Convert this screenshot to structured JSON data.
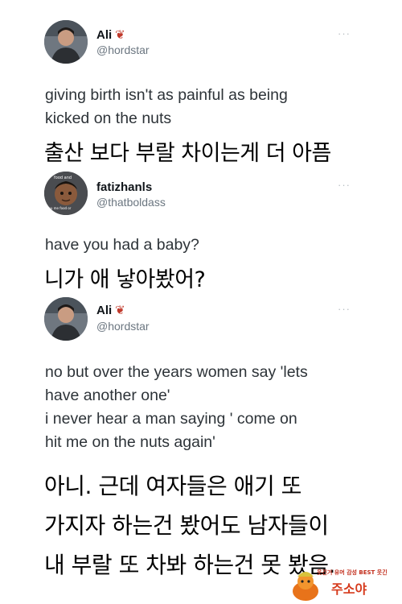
{
  "tweets": [
    {
      "name": "Ali",
      "handle": "@hordstar",
      "more": "···",
      "lines": [
        "giving birth isn't as painful as being",
        "kicked on the nuts"
      ],
      "translation": [
        "출산 보다 부랄 차이는게 더 아픔"
      ]
    },
    {
      "name": "fatizhanls",
      "handle": "@thatboldass",
      "more": "···",
      "avatar_text": "food and / you me food or ...",
      "lines": [
        "have you had a baby?"
      ],
      "translation": [
        "니가 애 낳아봤어?"
      ]
    },
    {
      "name": "Ali",
      "handle": "@hordstar",
      "more": "···",
      "lines": [
        "no but over the years women say 'lets",
        "have another one'",
        "i never hear a man saying ' come on",
        "hit me on the nuts again'"
      ],
      "translation": [
        "아니. 근데 여자들은 애기 또",
        "가지자 하는건 봤어도 남자들이",
        "내 부랄 또 차봐 하는건 못 봤음."
      ]
    }
  ],
  "watermark": {
    "top": "웃긴거 유머 감성 BEST 웃긴",
    "main": "주소야"
  },
  "colors": {
    "maple_leaf": "#c0392b",
    "handle": "#6b7680"
  }
}
